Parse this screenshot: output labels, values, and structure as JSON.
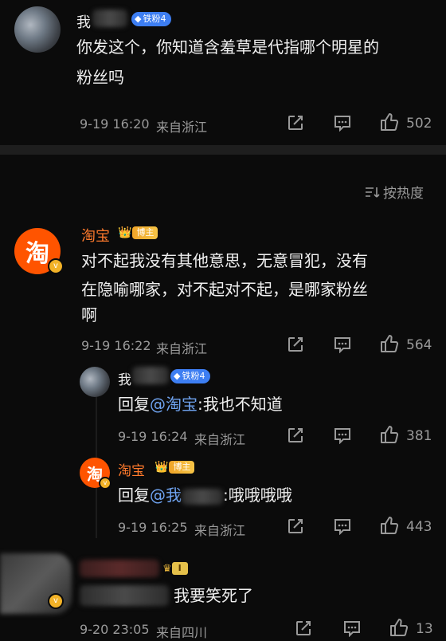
{
  "top_comment": {
    "username": "我",
    "fan_badge": "铁粉4",
    "text_line1": "你发这个，你知道含羞草是代指哪个明星的",
    "text_line2": "粉丝吗",
    "time": "9-19 16:20",
    "location": "来自浙江",
    "likes": "502"
  },
  "sort": {
    "label": "按热度"
  },
  "comment": {
    "username": "淘宝",
    "badge": "博主",
    "avatar_char": "淘",
    "text_line1": "对不起我没有其他意思，无意冒犯，没有",
    "text_line2": "在隐喻哪家，对不起对不起，是哪家粉丝",
    "text_line3": "啊",
    "time": "9-19 16:22",
    "location": "来自浙江",
    "likes": "564"
  },
  "reply1": {
    "username": "我",
    "fan_badge": "铁粉4",
    "prefix": "回复",
    "mention": "@淘宝",
    "text": ":我也不知道",
    "time": "9-19 16:24",
    "location": "来自浙江",
    "likes": "381"
  },
  "reply2": {
    "username": "淘宝",
    "badge": "博主",
    "avatar_char": "淘",
    "prefix": "回复",
    "mention": "@我",
    "text": ":哦哦哦哦",
    "time": "9-19 16:25",
    "location": "来自浙江",
    "likes": "443"
  },
  "comment3": {
    "badge": "I",
    "text": "我要笑死了",
    "time": "9-20 23:05",
    "location": "来自四川",
    "likes": "13"
  }
}
